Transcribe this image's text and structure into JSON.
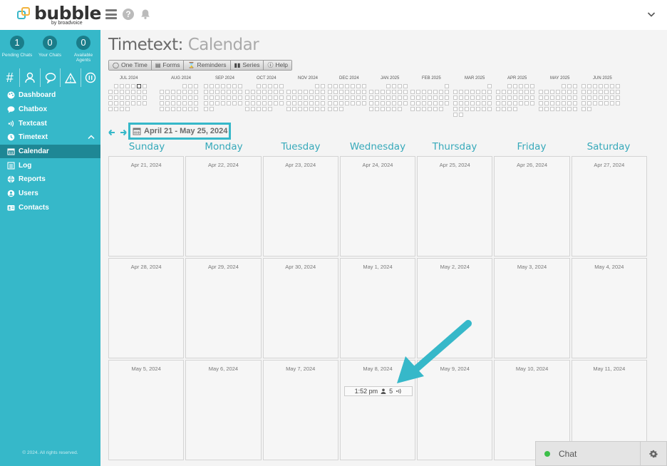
{
  "brand": {
    "name": "bubble",
    "tagline": "by broadvoice"
  },
  "sidebar": {
    "stats": [
      {
        "value": "1",
        "label": "Pending Chats"
      },
      {
        "value": "0",
        "label": "Your Chats"
      },
      {
        "value": "0",
        "label": "Available Agents"
      }
    ],
    "nav": [
      {
        "label": "Dashboard",
        "icon": "palette-icon"
      },
      {
        "label": "Chatbox",
        "icon": "chat-bubble-icon"
      },
      {
        "label": "Textcast",
        "icon": "broadcast-icon"
      },
      {
        "label": "Timetext",
        "icon": "clock-icon"
      },
      {
        "label": "Calendar",
        "icon": "calendar-icon"
      },
      {
        "label": "Log",
        "icon": "list-icon"
      },
      {
        "label": "Reports",
        "icon": "globe-icon"
      },
      {
        "label": "Users",
        "icon": "user-icon"
      },
      {
        "label": "Contacts",
        "icon": "contact-card-icon"
      }
    ],
    "copyright": "© 2024. All rights reserved."
  },
  "page": {
    "title_main": "Timetext:",
    "title_sub": "Calendar"
  },
  "toolbar": {
    "buttons": [
      {
        "label": "One Time",
        "icon": "chat-icon"
      },
      {
        "label": "Forms",
        "icon": "document-icon"
      },
      {
        "label": "Reminders",
        "icon": "hourglass-icon"
      },
      {
        "label": "Series",
        "icon": "bars-icon"
      },
      {
        "label": "Help",
        "icon": "question-icon"
      }
    ]
  },
  "mini_calendar": {
    "months": [
      "JUL 2024",
      "AUG 2024",
      "SEP 2024",
      "OCT 2024",
      "NOV 2024",
      "DEC 2024",
      "JAN 2025",
      "FEB 2025",
      "MAR 2025",
      "APR 2025",
      "MAY 2025",
      "JUN 2025"
    ]
  },
  "range": {
    "label": "April 21 - May 25, 2024"
  },
  "weekdays": [
    "Sunday",
    "Monday",
    "Tuesday",
    "Wednesday",
    "Thursday",
    "Friday",
    "Saturday"
  ],
  "weeks": [
    [
      "Apr 21, 2024",
      "Apr 22, 2024",
      "Apr 23, 2024",
      "Apr 24, 2024",
      "Apr 25, 2024",
      "Apr 26, 2024",
      "Apr 27, 2024"
    ],
    [
      "Apr 28, 2024",
      "Apr 29, 2024",
      "Apr 30, 2024",
      "May 1, 2024",
      "May 2, 2024",
      "May 3, 2024",
      "May 4, 2024"
    ],
    [
      "May 5, 2024",
      "May 6, 2024",
      "May 7, 2024",
      "May 8, 2024",
      "May 9, 2024",
      "May 10, 2024",
      "May 11, 2024"
    ]
  ],
  "event": {
    "time": "1:52 pm",
    "count": "5"
  },
  "chat_widget": {
    "label": "Chat"
  },
  "colors": {
    "accent": "#36b8c9",
    "sidebar_active": "#1e8795",
    "online": "#3cbf49"
  }
}
